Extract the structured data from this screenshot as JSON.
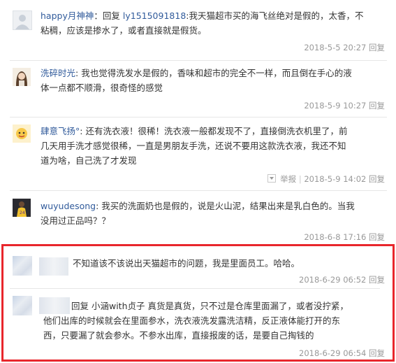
{
  "comments": [
    {
      "username": "happy月神神",
      "reply_word": "回复",
      "reply_to": "ly1515091818",
      "text": ":我天猫超市买的海飞丝绝对是假的，太香，不粘稠，应该是掺水了，或者直接就是假货。",
      "line1": ":我天猫超市买的海飞丝绝对是假的，太香，不",
      "line2": "粘稠，应该是掺水了，或者直接就是假货。",
      "date": "2018-5-5 20:27",
      "reply_label": "回复"
    },
    {
      "username": "洗碎时光",
      "line1": ": 我也觉得洗发水是假的，香味和超市的完全不一样，而且倒在手心的液",
      "line2": "体一点都不顺滑，很奇怪的感觉",
      "date": "2018-5-9 10:27",
      "reply_label": "回复"
    },
    {
      "username": "肆意飞扬°",
      "line1": ": 还有洗衣液！很稀！洗衣液一般都发现不了，直接倒洗衣机里了，前",
      "line2": "几天用手洗才感觉很稀，一直是男朋友手洗，还说不要用这款洗衣液，我还不知",
      "line3": "道为啥，自己洗了才发现",
      "report_label": "举报",
      "date": "2018-5-9 14:02",
      "reply_label": "回复"
    },
    {
      "username": "wuyudesong",
      "line1": ": 我买的洗面奶也是假的，说是火山泥，结果出来是乳白色的。当我",
      "line2": "没用过正品吗？？",
      "date": "2018-6-8 17:16",
      "reply_label": "回复"
    },
    {
      "line1": "不知道该不该说出天猫超市的问题，我是里面员工。哈哈。",
      "date": "2018-6-29 06:52",
      "reply_label": "回复"
    },
    {
      "line1": "回复 小涵with贞子 真货是真货，只不过是仓库里面漏了，或者没拧紧，",
      "line2": "他们出库的时候就会在里面参水，洗衣液洗发露洗洁精，反正液体能打开的东",
      "line3": "西，只要漏了就会参水。不参水出库，直接报废的话，是要自己掏钱的",
      "date": "2018-6-29 06:54",
      "reply_label": "回复"
    }
  ],
  "colors": {
    "username": "#315b9b",
    "highlight_border": "#e8262c",
    "meta": "#999999"
  }
}
